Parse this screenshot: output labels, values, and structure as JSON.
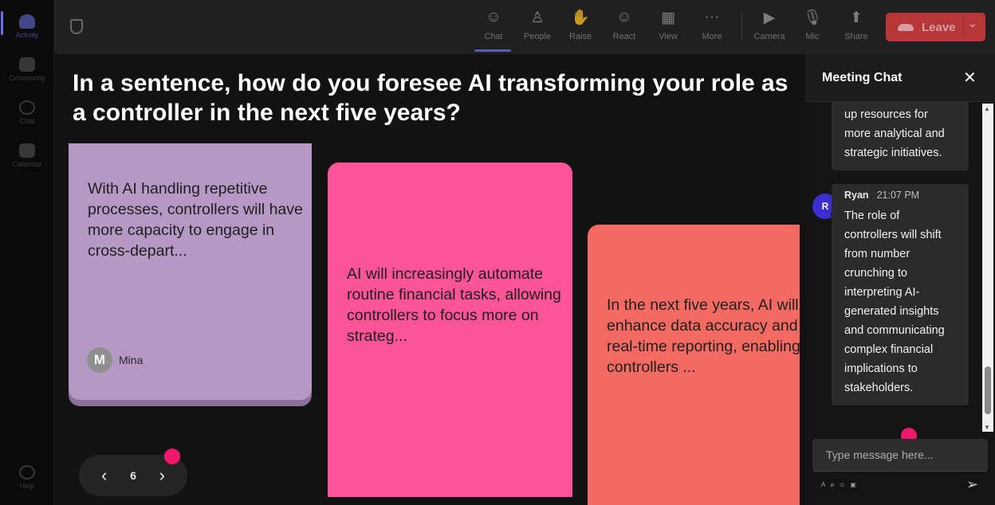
{
  "rail": {
    "items": [
      {
        "label": "Activity",
        "icon": "bell-icon"
      },
      {
        "label": "Community",
        "icon": "community-icon"
      },
      {
        "label": "Chat",
        "icon": "chat-icon"
      },
      {
        "label": "Calendar",
        "icon": "calendar-icon"
      }
    ],
    "help": {
      "label": "Help",
      "icon": "help-icon"
    }
  },
  "toolbar": {
    "buttons": [
      {
        "label": "Chat",
        "icon": "chat-icon",
        "glyph": "☺"
      },
      {
        "label": "People",
        "icon": "people-icon",
        "glyph": "♙"
      },
      {
        "label": "Raise",
        "icon": "hand-icon",
        "glyph": "✋"
      },
      {
        "label": "React",
        "icon": "smiley-icon",
        "glyph": "☺"
      },
      {
        "label": "View",
        "icon": "grid-icon",
        "glyph": "▦"
      },
      {
        "label": "More",
        "icon": "more-icon",
        "glyph": "···"
      },
      {
        "label": "Camera",
        "icon": "camera-off-icon",
        "glyph": "▶"
      },
      {
        "label": "Mic",
        "icon": "mic-icon",
        "glyph": "🎙"
      },
      {
        "label": "Share",
        "icon": "share-icon",
        "glyph": "⬆"
      }
    ],
    "leave_label": "Leave",
    "leave_color": "#d23a3f"
  },
  "stage": {
    "question": "In a sentence, how do you foresee AI transforming your role as a controller in the next five years?",
    "cards": [
      {
        "text": "With AI handling repetitive processes, controllers will have more capacity to engage in cross-depart...",
        "author": "Mina",
        "author_initial": "M",
        "color": "#b698c5"
      },
      {
        "text": "AI will increasingly automate routine financial tasks, allowing controllers to focus more on strateg...",
        "color": "#fc5497"
      },
      {
        "text": "In the next five years, AI will enhance data accuracy and real-time reporting, enabling controllers ...",
        "color": "#f26a61"
      }
    ],
    "pager": {
      "page": "6",
      "prev": "‹",
      "next": "›"
    }
  },
  "chat": {
    "title": "Meeting Chat",
    "close": "✕",
    "messages": [
      {
        "lines": [
          "up resources for",
          "more analytical and",
          "strategic initiatives."
        ]
      },
      {
        "author": "Ryan",
        "initial": "R",
        "time": "21:07 PM",
        "lines": [
          "The role of",
          "controllers will shift",
          "from number",
          "crunching to",
          "interpreting AI-",
          "generated insights",
          "and communicating",
          "complex financial",
          "implications to",
          "stakeholders."
        ]
      }
    ],
    "input_placeholder": "Type message here...",
    "send": "➢"
  },
  "accent_color": "#6b6fe0",
  "notification_color": "#f0186a"
}
